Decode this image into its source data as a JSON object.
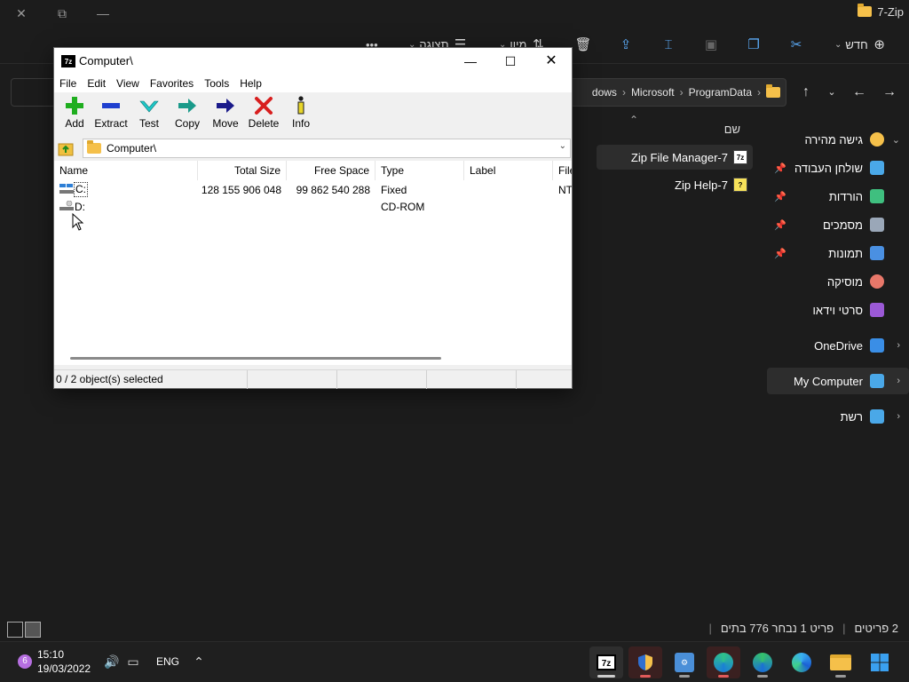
{
  "explorer": {
    "title": "7-Zip",
    "toolbar": {
      "new_label": "חדש",
      "sort_label": "מיון",
      "view_label": "תצוגה",
      "more_label": "•••"
    },
    "breadcrumb": [
      "ProgramData",
      "Microsoft",
      "dows"
    ],
    "column_name": "שם",
    "files": [
      {
        "name": "7-Zip File Manager",
        "icon": "7zip-icon",
        "selected": true
      },
      {
        "name": "7-Zip Help",
        "icon": "help-icon",
        "selected": false
      }
    ],
    "nav": [
      {
        "label": "גישה מהירה",
        "icon": "star-icon",
        "color": "#f5c04a",
        "chev": "expanded"
      },
      {
        "label": "שולחן העבודה",
        "icon": "desktop-icon",
        "color": "#4aa8e8",
        "pin": true
      },
      {
        "label": "הורדות",
        "icon": "download-icon",
        "color": "#3fbf7f",
        "pin": true
      },
      {
        "label": "מסמכים",
        "icon": "documents-icon",
        "color": "#9aa7b8",
        "pin": true
      },
      {
        "label": "תמונות",
        "icon": "pictures-icon",
        "color": "#4a90e2",
        "pin": true
      },
      {
        "label": "מוסיקה",
        "icon": "music-icon",
        "color": "#e8786a"
      },
      {
        "label": "סרטי וידאו",
        "icon": "videos-icon",
        "color": "#9b59d6"
      },
      {
        "label": "OneDrive",
        "icon": "onedrive-icon",
        "color": "#3a8ee6",
        "chev": "collapsed"
      },
      {
        "label": "My Computer",
        "icon": "computer-icon",
        "color": "#4aa8e8",
        "chev": "collapsed",
        "selected": true
      },
      {
        "label": "רשת",
        "icon": "network-icon",
        "color": "#4aa8e8",
        "chev": "collapsed"
      }
    ],
    "status": {
      "items_count": "2 פריטים",
      "selected_info": "פריט 1 נבחר 776 בתים"
    }
  },
  "zip": {
    "title": "Computer\\",
    "menu": [
      "File",
      "Edit",
      "View",
      "Favorites",
      "Tools",
      "Help"
    ],
    "tools": [
      {
        "label": "Add",
        "icon": "add-icon"
      },
      {
        "label": "Extract",
        "icon": "extract-icon"
      },
      {
        "label": "Test",
        "icon": "test-icon"
      },
      {
        "label": "Copy",
        "icon": "copy-icon"
      },
      {
        "label": "Move",
        "icon": "move-icon"
      },
      {
        "label": "Delete",
        "icon": "delete-icon"
      },
      {
        "label": "Info",
        "icon": "info-icon"
      }
    ],
    "address": "Computer\\",
    "columns": [
      "Name",
      "Total Size",
      "Free Space",
      "Type",
      "Label",
      "File"
    ],
    "rows": [
      {
        "name": "C:",
        "total": "128 155 906 048",
        "free": "99 862 540 288",
        "type": "Fixed",
        "label": "",
        "fs": "NT"
      },
      {
        "name": "D:",
        "total": "",
        "free": "",
        "type": "CD-ROM",
        "label": "",
        "fs": ""
      }
    ],
    "status": "0 / 2 object(s) selected"
  },
  "taskbar": {
    "badge": "6",
    "time": "15:10",
    "date": "19/03/2022",
    "lang": "ENG"
  }
}
